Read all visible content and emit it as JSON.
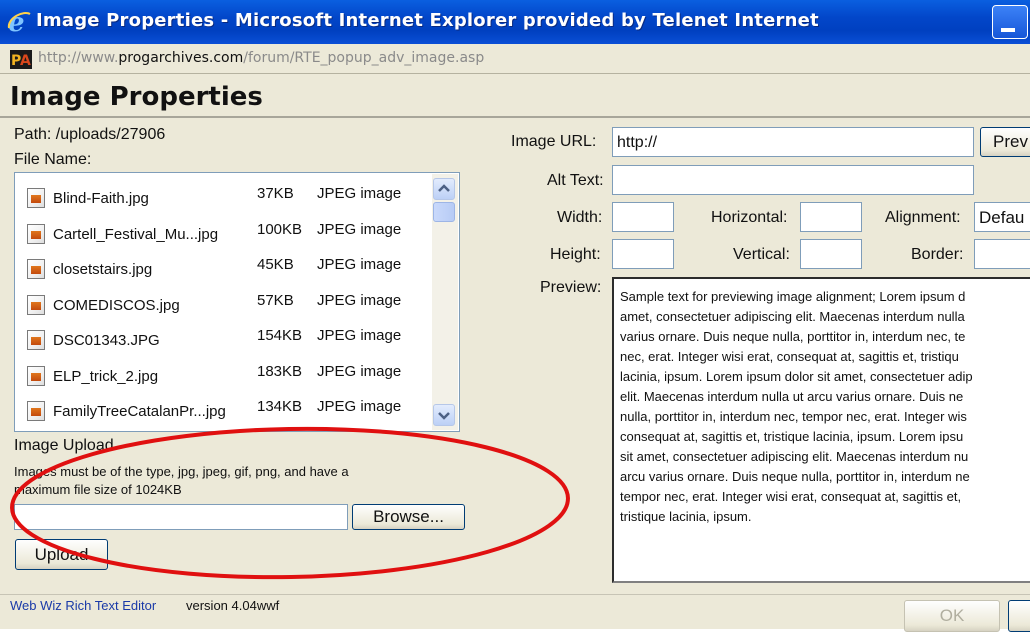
{
  "window": {
    "title": "Image Properties - Microsoft Internet Explorer provided by Telenet Internet",
    "address_prefix": "http://www.",
    "address_domain": "progarchives.com",
    "address_path": "/forum/RTE_popup_adv_image.asp"
  },
  "dialog": {
    "heading": "Image Properties",
    "path_label": "Path: /uploads/27906",
    "file_name_label": "File Name:"
  },
  "files": [
    {
      "name": "Blind-Faith.jpg",
      "size": "37KB",
      "type": "JPEG image"
    },
    {
      "name": "Cartell_Festival_Mu...jpg",
      "size": "100KB",
      "type": "JPEG image"
    },
    {
      "name": "closetstairs.jpg",
      "size": "45KB",
      "type": "JPEG image"
    },
    {
      "name": "COMEDISCOS.jpg",
      "size": "57KB",
      "type": "JPEG image"
    },
    {
      "name": "DSC01343.JPG",
      "size": "154KB",
      "type": "JPEG image"
    },
    {
      "name": "ELP_trick_2.jpg",
      "size": "183KB",
      "type": "JPEG image"
    },
    {
      "name": "FamilyTreeCatalanPr...jpg",
      "size": "134KB",
      "type": "JPEG image"
    }
  ],
  "upload": {
    "heading": "Image Upload",
    "note_line1": "Images must be of the type, jpg, jpeg, gif, png, and have a",
    "note_line2": "maximum file size of 1024KB",
    "browse_label": "Browse...",
    "upload_label": "Upload"
  },
  "form": {
    "image_url_label": "Image URL:",
    "image_url_value": "http://",
    "preview_button_label": "Prev",
    "alt_text_label": "Alt Text:",
    "width_label": "Width:",
    "height_label": "Height:",
    "horizontal_label": "Horizontal:",
    "vertical_label": "Vertical:",
    "alignment_label": "Alignment:",
    "alignment_value": "Defau",
    "border_label": "Border:",
    "preview_label": "Preview:"
  },
  "preview_lines": [
    "Sample text for previewing image alignment; Lorem ipsum d",
    "amet, consectetuer adipiscing elit. Maecenas interdum nulla",
    "varius ornare. Duis neque nulla, porttitor in, interdum nec, te",
    "nec, erat. Integer wisi erat, consequat at, sagittis et, tristiqu",
    "lacinia, ipsum. Lorem ipsum dolor sit amet, consectetuer adip",
    "elit. Maecenas interdum nulla ut arcu varius ornare. Duis ne",
    "nulla, porttitor in, interdum nec, tempor nec, erat. Integer wis",
    "consequat at, sagittis et, tristique lacinia, ipsum. Lorem ipsu",
    "sit amet, consectetuer adipiscing elit. Maecenas interdum nu",
    "arcu varius ornare. Duis neque nulla, porttitor in, interdum ne",
    "tempor nec, erat. Integer wisi erat, consequat at, sagittis et,",
    "tristique lacinia, ipsum."
  ],
  "footer": {
    "editor_link": "Web Wiz Rich Text Editor",
    "version": "version 4.04wwf",
    "ok_label": "OK"
  },
  "colors": {
    "titlebar": "#0246c9",
    "annotation_ellipse": "#e01010"
  }
}
